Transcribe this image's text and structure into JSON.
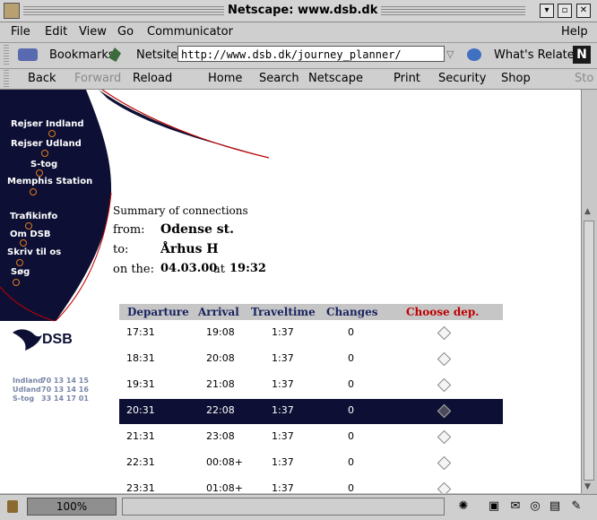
{
  "window": {
    "title": "Netscape: www.dsb.dk"
  },
  "menu": {
    "items": [
      "File",
      "Edit",
      "View",
      "Go",
      "Communicator"
    ],
    "help": "Help"
  },
  "location": {
    "bookmarks_label": "Bookmarks",
    "netsite_label": "Netsite:",
    "url": "http://www.dsb.dk/journey_planner/",
    "related_label": "What's Related"
  },
  "nav": {
    "back": "Back",
    "forward": "Forward",
    "reload": "Reload",
    "home": "Home",
    "search": "Search",
    "netscape": "Netscape",
    "print": "Print",
    "security": "Security",
    "shop": "Shop",
    "stop": "Sto"
  },
  "sidebar": {
    "links": [
      "Rejser Indland",
      "Rejser Udland",
      "S-tog",
      "Memphis Station",
      "Trafikinfo",
      "Om DSB",
      "Skriv til os",
      "Søg"
    ],
    "logo_text": "DSB",
    "phones": [
      {
        "label": "Indland",
        "number": "70 13 14 15"
      },
      {
        "label": "Udland",
        "number": "70 13 14 16"
      },
      {
        "label": "S-tog",
        "number": "33 14 17 01"
      }
    ]
  },
  "summary": {
    "heading": "Summary of connections",
    "from_label": "from:",
    "from_value": "Odense st.",
    "to_label": "to:",
    "to_value": "Århus H",
    "on_label": "on the:",
    "date": "04.03.00",
    "at_label": "at",
    "time": "19:32"
  },
  "table": {
    "headers": {
      "departure": "Departure",
      "arrival": "Arrival",
      "travel": "Traveltime",
      "changes": "Changes",
      "choose": "Choose dep."
    },
    "rows": [
      {
        "dep": "17:31",
        "arr": "19:08",
        "travel": "1:37",
        "changes": "0",
        "selected": false
      },
      {
        "dep": "18:31",
        "arr": "20:08",
        "travel": "1:37",
        "changes": "0",
        "selected": false
      },
      {
        "dep": "19:31",
        "arr": "21:08",
        "travel": "1:37",
        "changes": "0",
        "selected": false
      },
      {
        "dep": "20:31",
        "arr": "22:08",
        "travel": "1:37",
        "changes": "0",
        "selected": true
      },
      {
        "dep": "21:31",
        "arr": "23:08",
        "travel": "1:37",
        "changes": "0",
        "selected": false
      },
      {
        "dep": "22:31",
        "arr": "00:08+",
        "travel": "1:37",
        "changes": "0",
        "selected": false
      },
      {
        "dep": "23:31",
        "arr": "01:08+",
        "travel": "1:37",
        "changes": "0",
        "selected": false
      }
    ]
  },
  "status": {
    "zoom": "100%"
  },
  "colors": {
    "navy": "#0d1034",
    "accent_red": "#c00000",
    "header_text": "#1a2460",
    "link_dot": "#e07a20"
  }
}
